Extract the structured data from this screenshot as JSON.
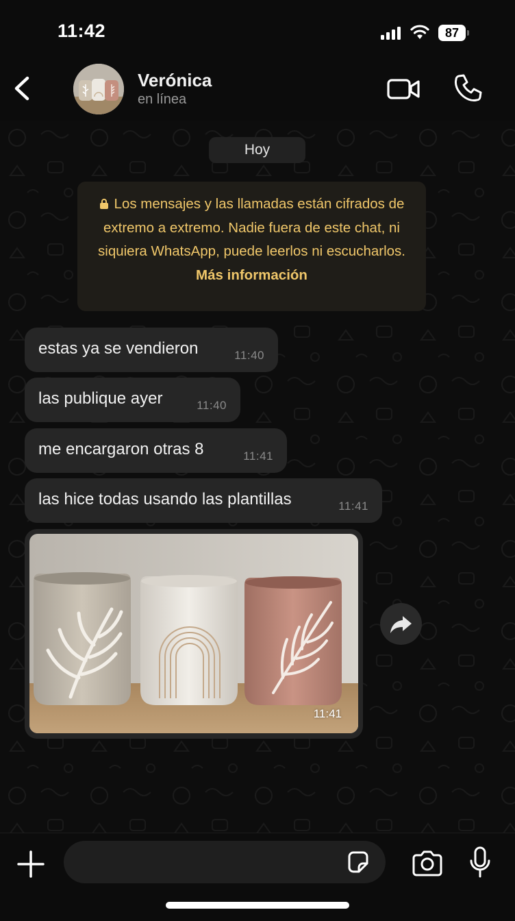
{
  "status_bar": {
    "time": "11:42",
    "battery": "87"
  },
  "header": {
    "contact_name": "Verónica",
    "contact_status": "en línea",
    "icons": [
      "back-chevron-icon",
      "video-camera-icon",
      "phone-icon"
    ]
  },
  "chat": {
    "date_label": "Hoy",
    "encryption_notice": {
      "text": "Los mensajes y las llamadas están cifrados de extremo a extremo. Nadie fuera de este chat, ni siquiera WhatsApp, puede leerlos ni escucharlos.",
      "link": "Más información",
      "color": "#f0c76a"
    },
    "messages": [
      {
        "text": "estas ya se vendieron",
        "time": "11:40"
      },
      {
        "text": "las publique ayer",
        "time": "11:40"
      },
      {
        "text": "me encargaron otras 8",
        "time": "11:41"
      },
      {
        "text": "las hice todas usando las plantillas",
        "time": "11:41"
      }
    ],
    "image_message": {
      "time": "11:41",
      "description_icon": "photo-three-ceramic-cups"
    }
  },
  "composer": {
    "placeholder": "",
    "icons": [
      "plus-icon",
      "sticker-icon",
      "camera-icon",
      "microphone-icon"
    ]
  },
  "colors": {
    "background": "#0c0c0c",
    "bubble": "#262626",
    "accent_text": "#f0c76a"
  }
}
